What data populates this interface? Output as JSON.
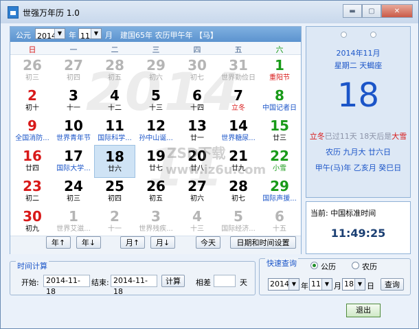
{
  "window": {
    "title": "世强万年历 1.0",
    "min": "▬",
    "max": "▢",
    "close": "✕"
  },
  "header": {
    "gongyuan_label": "公元",
    "year_value": "2014",
    "year_unit": "年",
    "month_value": "11",
    "month_unit": "月",
    "info": "建国65年 农历甲午年 【马】"
  },
  "weekdays": [
    "日",
    "一",
    "二",
    "三",
    "四",
    "五",
    "六"
  ],
  "watermark": {
    "year": "2014",
    "month": "11"
  },
  "days": [
    {
      "n": "26",
      "s": "初三",
      "dim": true
    },
    {
      "n": "27",
      "s": "初四",
      "dim": true
    },
    {
      "n": "28",
      "s": "初五",
      "dim": true
    },
    {
      "n": "29",
      "s": "初六",
      "dim": true
    },
    {
      "n": "30",
      "s": "初七",
      "dim": true
    },
    {
      "n": "31",
      "s": "世界勤俭日",
      "dim": true
    },
    {
      "n": "1",
      "s": "重阳节",
      "dim": false,
      "sc": "red"
    },
    {
      "n": "2",
      "s": "初十"
    },
    {
      "n": "3",
      "s": "十一"
    },
    {
      "n": "4",
      "s": "十二"
    },
    {
      "n": "5",
      "s": "十三"
    },
    {
      "n": "6",
      "s": "十四"
    },
    {
      "n": "7",
      "s": "立冬",
      "sc": "red"
    },
    {
      "n": "8",
      "s": "中国记者日",
      "sc": "blue"
    },
    {
      "n": "9",
      "s": "全国消防...",
      "sc": "blue"
    },
    {
      "n": "10",
      "s": "世界青年节",
      "sc": "blue"
    },
    {
      "n": "11",
      "s": "国际科学...",
      "sc": "blue"
    },
    {
      "n": "12",
      "s": "孙中山诞...",
      "sc": "blue"
    },
    {
      "n": "13",
      "s": "廿一"
    },
    {
      "n": "14",
      "s": "世界糖尿...",
      "sc": "blue"
    },
    {
      "n": "15",
      "s": "廿三"
    },
    {
      "n": "16",
      "s": "廿四"
    },
    {
      "n": "17",
      "s": "国际大学...",
      "sc": "blue"
    },
    {
      "n": "18",
      "s": "廿六",
      "today": true
    },
    {
      "n": "19",
      "s": "廿七"
    },
    {
      "n": "20",
      "s": "廿八"
    },
    {
      "n": "21",
      "s": "廿九"
    },
    {
      "n": "22",
      "s": "小雪",
      "sc": "green"
    },
    {
      "n": "23",
      "s": "初二"
    },
    {
      "n": "24",
      "s": "初三"
    },
    {
      "n": "25",
      "s": "初四"
    },
    {
      "n": "26",
      "s": "初五"
    },
    {
      "n": "27",
      "s": "初六"
    },
    {
      "n": "28",
      "s": "初七"
    },
    {
      "n": "29",
      "s": "国际声援...",
      "sc": "blue"
    },
    {
      "n": "30",
      "s": "初九"
    },
    {
      "n": "1",
      "s": "世界艾滋...",
      "dim": true
    },
    {
      "n": "2",
      "s": "十一",
      "dim": true
    },
    {
      "n": "3",
      "s": "世界残疾...",
      "dim": true
    },
    {
      "n": "4",
      "s": "十三",
      "dim": true
    },
    {
      "n": "5",
      "s": "国际经济...",
      "dim": true
    },
    {
      "n": "6",
      "s": "十五",
      "dim": true
    }
  ],
  "buttons": {
    "prev_year": "年↑",
    "next_year": "年↓",
    "prev_month": "月↑",
    "next_month": "月↓",
    "today": "今天",
    "datetime_settings": "日期和时间设置"
  },
  "detail": {
    "date": "2014年11月",
    "weekday_star": "星期二 天蝎座",
    "day": "18",
    "term_prev": "立冬",
    "term_prev_text": "已过11天",
    "term_next_text": "18天后是",
    "term_next": "大雪",
    "lunar": "农历 九月大 廿六日",
    "ganzhi": "甲午(马)年 乙亥月 癸巳日"
  },
  "clock": {
    "label": "当前: 中国标准时间",
    "time": "11:49:25"
  },
  "calc": {
    "title": "时间计算",
    "start_label": "开始:",
    "start_value": "2014-11-18",
    "end_label": "结束:",
    "end_value": "2014-11-18",
    "calc_button": "计算",
    "diff_label": "相差",
    "diff_value": "",
    "day_unit": "天"
  },
  "query": {
    "title": "快速查询",
    "solar_label": "公历",
    "lunar_label": "农历",
    "year_value": "2014",
    "year_unit": "年",
    "month_value": "11",
    "month_unit": "月",
    "day_value": "18",
    "day_unit": "日",
    "query_button": "查询"
  },
  "exit_button": "退出",
  "site_watermark": {
    "line1": "ZSD下载",
    "line2": "www.iz6u.com"
  },
  "colors": {
    "accent": "#1b55c8",
    "red": "#d81a1a",
    "green": "#189a18",
    "header": "#5c93cf"
  }
}
